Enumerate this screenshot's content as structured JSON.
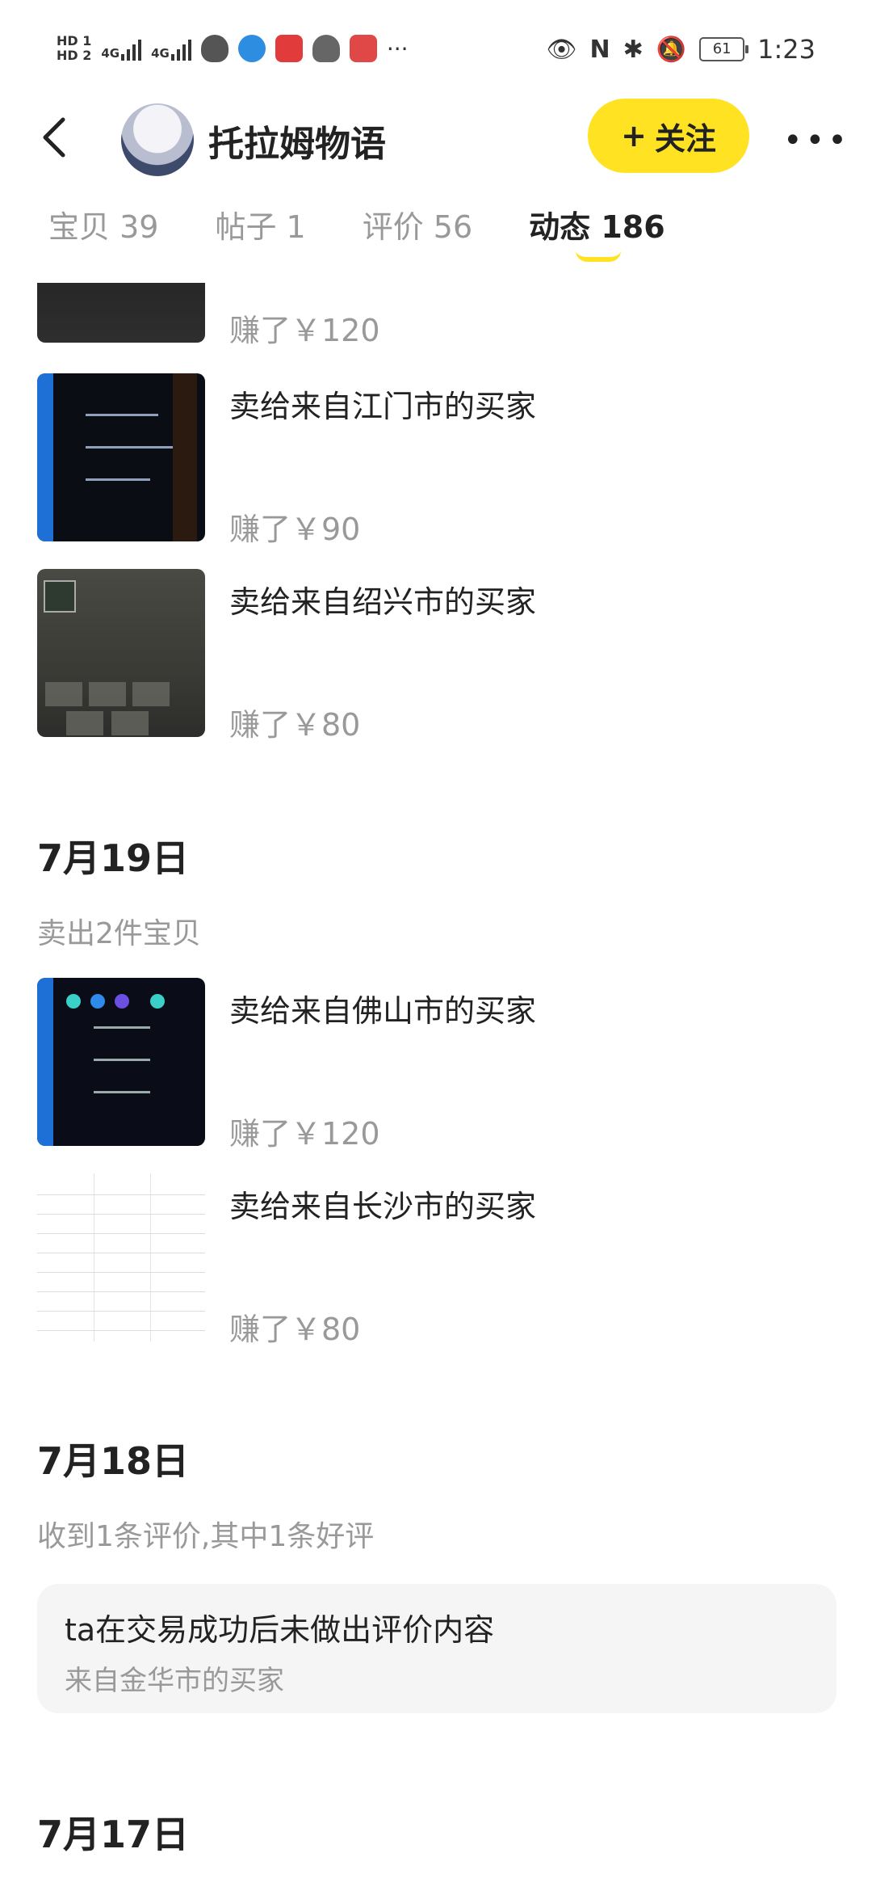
{
  "status_bar": {
    "hd1": "HD 1",
    "hd2": "HD 2",
    "net1": "4G",
    "net2": "4G",
    "more": "···",
    "battery": "61",
    "time": "1:23"
  },
  "header": {
    "shop_name": "托拉姆物语",
    "follow_plus": "+",
    "follow_label": "关注",
    "more": "•••"
  },
  "tabs": [
    {
      "label": "宝贝 39"
    },
    {
      "label": "帖子 1"
    },
    {
      "label": "评价 56"
    },
    {
      "label": "动态 186",
      "active": true
    }
  ],
  "feed": {
    "top_partial": {
      "earn": "赚了￥120"
    },
    "group0_items": [
      {
        "title": "卖给来自江门市的买家",
        "earn": "赚了￥90"
      },
      {
        "title": "卖给来自绍兴市的买家",
        "earn": "赚了￥80"
      }
    ],
    "day1": {
      "date": "7月19日",
      "summary": "卖出2件宝贝",
      "items": [
        {
          "title": "卖给来自佛山市的买家",
          "earn": "赚了￥120"
        },
        {
          "title": "卖给来自长沙市的买家",
          "earn": "赚了￥80"
        }
      ]
    },
    "day2": {
      "date": "7月18日",
      "summary": "收到1条评价,其中1条好评",
      "review": {
        "text": "ta在交易成功后未做出评价内容",
        "from": "来自金华市的买家"
      }
    },
    "day3": {
      "date": "7月17日"
    }
  },
  "colors": {
    "accent": "#ffe221",
    "muted": "#999999",
    "text": "#222222"
  }
}
